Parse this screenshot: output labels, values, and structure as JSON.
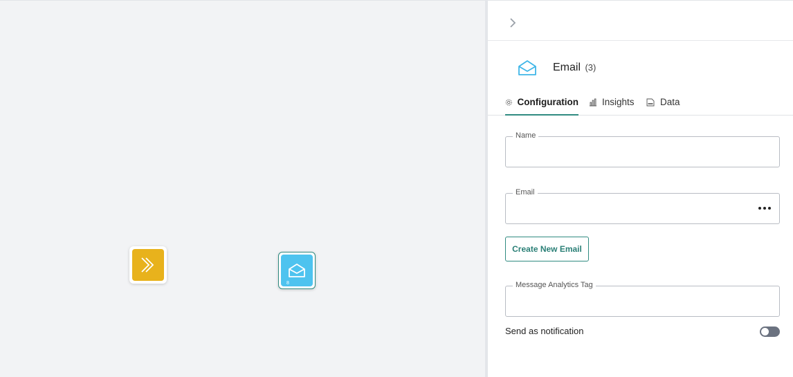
{
  "canvas": {
    "nodes": [
      {
        "name": "trigger-node",
        "icon": "double-chevron-right-icon",
        "color": "#e8b21c"
      },
      {
        "name": "email-node",
        "icon": "envelope-open-icon",
        "color": "#4ec3ef",
        "badge": "8"
      }
    ]
  },
  "panel": {
    "collapse_icon": "chevron-right-icon",
    "header": {
      "icon": "envelope-open-icon",
      "title": "Email",
      "count": "(3)"
    },
    "tabs": [
      {
        "label": "Configuration",
        "icon": "gear-icon",
        "active": true
      },
      {
        "label": "Insights",
        "icon": "bar-chart-icon",
        "active": false
      },
      {
        "label": "Data",
        "icon": "sql-icon",
        "active": false
      }
    ],
    "form": {
      "name_label": "Name",
      "name_value": "",
      "email_label": "Email",
      "email_value": "",
      "create_button": "Create New Email",
      "tag_label": "Message Analytics Tag",
      "tag_value": "",
      "notify_label": "Send as notification",
      "notify_enabled": false
    }
  },
  "colors": {
    "accent": "#2f8a80",
    "trigger": "#e8b21c",
    "email": "#4ec3ef",
    "canvas_bg": "#f2f3f5"
  }
}
